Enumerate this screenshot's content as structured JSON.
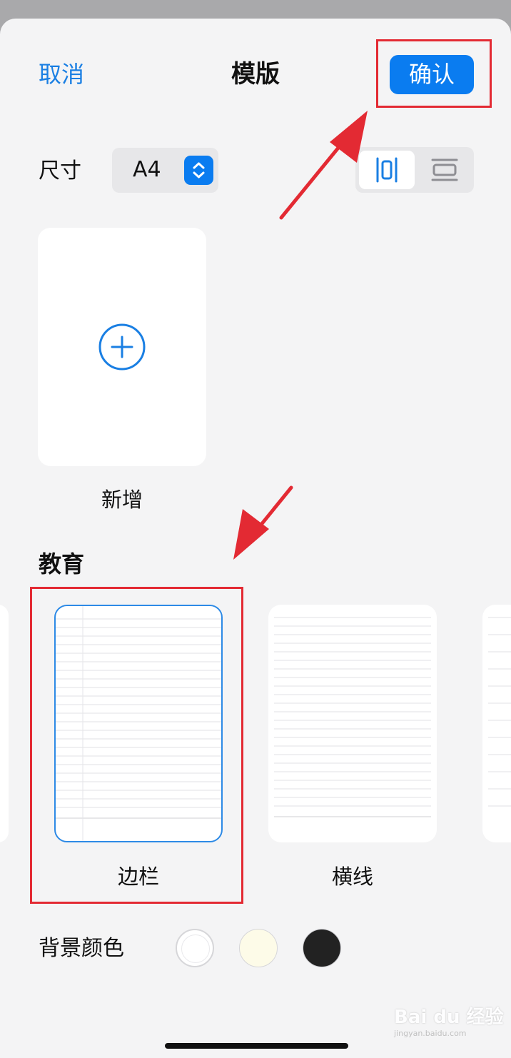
{
  "header": {
    "cancel_label": "取消",
    "title": "模版",
    "confirm_label": "确认"
  },
  "size": {
    "label": "尺寸",
    "value": "A4",
    "stepper_icon": "chevron-up-down-icon"
  },
  "orientation": {
    "options": [
      {
        "icon": "portrait-icon",
        "selected": true
      },
      {
        "icon": "landscape-icon",
        "selected": false
      }
    ]
  },
  "new_template": {
    "label": "新增",
    "icon": "plus-circle-icon"
  },
  "section": {
    "title": "教育",
    "templates": [
      {
        "label": "边栏",
        "style": "margin-lined",
        "selected": true
      },
      {
        "label": "横线",
        "style": "lined",
        "selected": false
      }
    ]
  },
  "background": {
    "label": "背景颜色",
    "swatches": [
      "#ffffff",
      "#fdfbe8",
      "#222222"
    ]
  },
  "watermark": {
    "text": "Bai du 经验",
    "sub": "jingyan.baidu.com"
  },
  "colors": {
    "accent": "#0a7cf0",
    "annotation": "#e32a33",
    "sheet": "#f4f4f5"
  }
}
